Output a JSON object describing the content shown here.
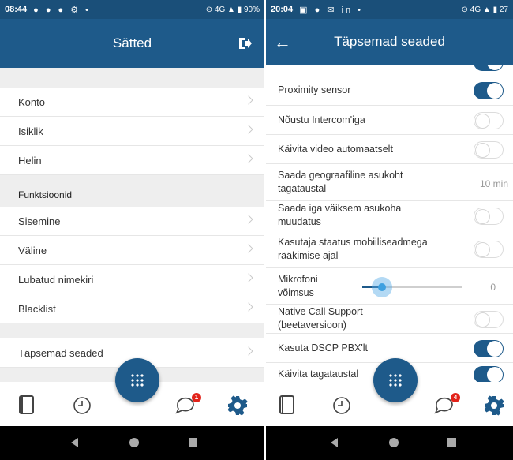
{
  "left": {
    "status": {
      "time": "08:44",
      "icons": "● ● ● ⚙ •",
      "right": "⊙ 4G ▲ ▮ 90%"
    },
    "title": "Sätted",
    "items_top": [
      "Konto",
      "Isiklik",
      "Helin"
    ],
    "section_label": "Funktsioonid",
    "items_mid": [
      "Sisemine",
      "Väline",
      "Lubatud nimekiri",
      "Blacklist"
    ],
    "item_advanced": "Täpsemad seaded",
    "badge_count": "1"
  },
  "right": {
    "status": {
      "time": "20:04",
      "icons": "▣ ● ✉ in •",
      "right": "⊙ 4G ▲ ▮ 27"
    },
    "title": "Täpsemad seaded",
    "settings": [
      {
        "label": "Proximity sensor",
        "control": "toggle",
        "on": true
      },
      {
        "label": "Nõustu Intercom'iga",
        "control": "toggle",
        "on": false
      },
      {
        "label": "Käivita video automaatselt",
        "control": "toggle",
        "on": false
      },
      {
        "label": "Saada geograafiline asukoht tagataustal",
        "control": "value",
        "value": "10 min"
      },
      {
        "label": "Saada iga väiksem asukoha muudatus",
        "control": "toggle",
        "on": false
      },
      {
        "label": "Kasutaja staatus mobiiliseadmega rääkimise ajal",
        "control": "toggle",
        "on": false
      },
      {
        "label": "Mikrofoni võimsus",
        "control": "slider",
        "value": "0",
        "level": 0.2
      },
      {
        "label": "Native Call Support (beetaversioon)",
        "control": "toggle",
        "on": false
      },
      {
        "label": "Kasuta DSCP PBX'lt",
        "control": "toggle",
        "on": true
      },
      {
        "label": "Käivita tagataustal",
        "control": "toggle",
        "on": true
      }
    ],
    "badge_count": "4"
  },
  "colors": {
    "primary": "#1e5a8a",
    "statusbar": "#1a4f79",
    "badge": "#e2231a",
    "slider_knob": "#3da0e0"
  },
  "nav_icons": [
    "contacts-book-icon",
    "history-clock-icon",
    "dialpad-icon",
    "chat-bubble-icon",
    "settings-gear-icon"
  ]
}
